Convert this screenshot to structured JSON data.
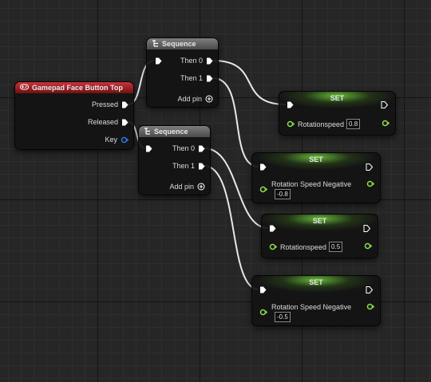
{
  "nodes": {
    "input_event": {
      "title": "Gamepad Face Button Top",
      "pins": {
        "pressed": "Pressed",
        "released": "Released",
        "key": "Key"
      }
    },
    "sequence_1": {
      "title": "Sequence",
      "then0": "Then 0",
      "then1": "Then 1",
      "add_pin": "Add pin"
    },
    "sequence_2": {
      "title": "Sequence",
      "then0": "Then 0",
      "then1": "Then 1",
      "add_pin": "Add pin"
    },
    "set_1": {
      "title": "SET",
      "var": "Rotationspeed",
      "value": "0.8"
    },
    "set_2": {
      "title": "SET",
      "var": "Rotation Speed Negative",
      "value": "-0.8"
    },
    "set_3": {
      "title": "SET",
      "var": "Rotationspeed",
      "value": "0.5"
    },
    "set_4": {
      "title": "SET",
      "var": "Rotation Speed Negative",
      "value": "-0.5"
    }
  },
  "icons": {
    "event": "gamepad-icon",
    "sequence": "sequence-icon",
    "add": "add-pin-icon",
    "key_pin": "struct-pin-icon"
  },
  "colors": {
    "exec": "#ffffff",
    "float_pin": "#8ee04c",
    "key_pin": "#2f7ce8",
    "event_header": "#a8262c",
    "set_header": "#5aa532"
  }
}
